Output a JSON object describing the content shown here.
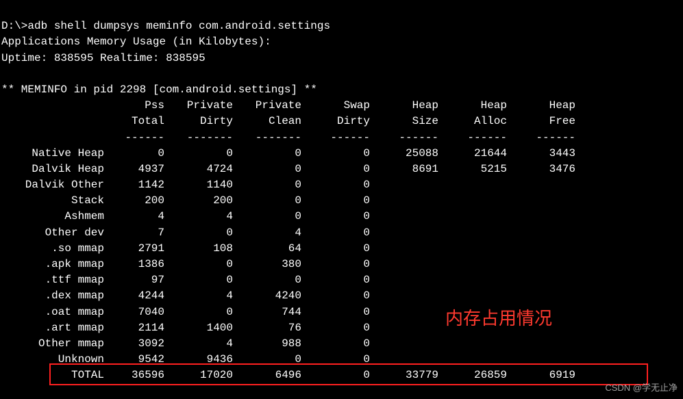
{
  "prompt": {
    "path": "D:\\>",
    "command": "adb shell dumpsys meminfo com.android.settings"
  },
  "header": {
    "line1": "Applications Memory Usage (in Kilobytes):",
    "uptime_label": "Uptime:",
    "uptime": "838595",
    "realtime_label": "Realtime:",
    "realtime": "838595",
    "meminfo_prefix": "** MEMINFO in pid",
    "pid": "2298",
    "pkg_open": "[",
    "package": "com.android.settings",
    "pkg_close": "] **"
  },
  "columns": {
    "r1": [
      "Pss",
      "Private",
      "Private",
      "Swap",
      "Heap",
      "Heap",
      "Heap"
    ],
    "r2": [
      "Total",
      "Dirty",
      "Clean",
      "Dirty",
      "Size",
      "Alloc",
      "Free"
    ]
  },
  "rows": [
    {
      "label": "Native Heap",
      "v": [
        "0",
        "0",
        "0",
        "0",
        "25088",
        "21644",
        "3443"
      ]
    },
    {
      "label": "Dalvik Heap",
      "v": [
        "4937",
        "4724",
        "0",
        "0",
        "8691",
        "5215",
        "3476"
      ]
    },
    {
      "label": "Dalvik Other",
      "v": [
        "1142",
        "1140",
        "0",
        "0",
        "",
        "",
        ""
      ]
    },
    {
      "label": "Stack",
      "v": [
        "200",
        "200",
        "0",
        "0",
        "",
        "",
        ""
      ]
    },
    {
      "label": "Ashmem",
      "v": [
        "4",
        "4",
        "0",
        "0",
        "",
        "",
        ""
      ]
    },
    {
      "label": "Other dev",
      "v": [
        "7",
        "0",
        "4",
        "0",
        "",
        "",
        ""
      ]
    },
    {
      "label": ".so mmap",
      "v": [
        "2791",
        "108",
        "64",
        "0",
        "",
        "",
        ""
      ]
    },
    {
      "label": ".apk mmap",
      "v": [
        "1386",
        "0",
        "380",
        "0",
        "",
        "",
        ""
      ]
    },
    {
      "label": ".ttf mmap",
      "v": [
        "97",
        "0",
        "0",
        "0",
        "",
        "",
        ""
      ]
    },
    {
      "label": ".dex mmap",
      "v": [
        "4244",
        "4",
        "4240",
        "0",
        "",
        "",
        ""
      ]
    },
    {
      "label": ".oat mmap",
      "v": [
        "7040",
        "0",
        "744",
        "0",
        "",
        "",
        ""
      ]
    },
    {
      "label": ".art mmap",
      "v": [
        "2114",
        "1400",
        "76",
        "0",
        "",
        "",
        ""
      ]
    },
    {
      "label": "Other mmap",
      "v": [
        "3092",
        "4",
        "988",
        "0",
        "",
        "",
        ""
      ]
    },
    {
      "label": "Unknown",
      "v": [
        "9542",
        "9436",
        "0",
        "0",
        "",
        "",
        ""
      ]
    },
    {
      "label": "TOTAL",
      "v": [
        "36596",
        "17020",
        "6496",
        "0",
        "33779",
        "26859",
        "6919"
      ]
    }
  ],
  "annotation": "内存占用情况",
  "watermark": "CSDN @学无止净"
}
